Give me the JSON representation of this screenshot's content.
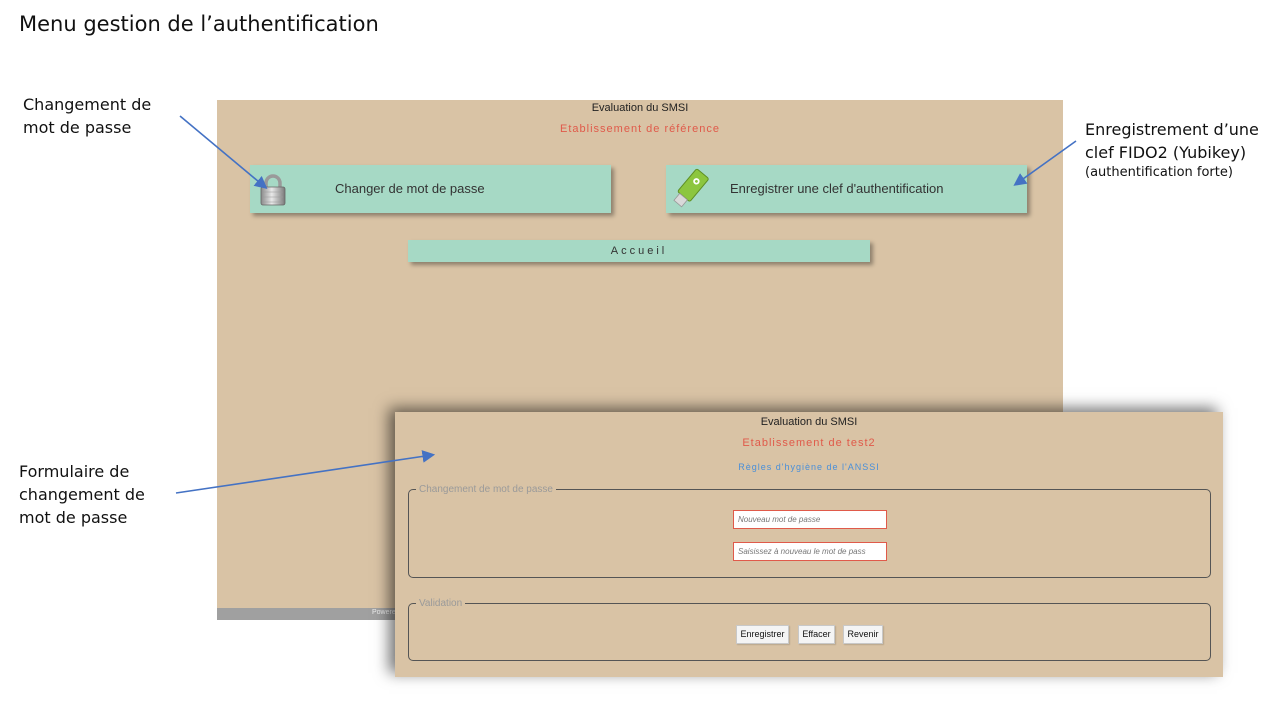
{
  "slide": {
    "title": "Menu gestion de l’authentification"
  },
  "callouts": {
    "password_change": [
      "Changement de",
      "mot de passe"
    ],
    "fido_key": [
      "Enregistrement d’une",
      "clef FIDO2 (Yubikey)"
    ],
    "fido_key_note": "(authentification forte)",
    "form": [
      "Formulaire de",
      "changement de",
      "mot de passe"
    ]
  },
  "main_screen": {
    "app_title": "Evaluation du SMSI",
    "establishment": "Etablissement de référence",
    "tiles": [
      {
        "label": "Changer de mot de passe",
        "icon": "padlock-icon"
      },
      {
        "label": "Enregistrer une clef d'authentification",
        "icon": "usb-key-icon"
      }
    ],
    "home_button": "Accueil",
    "footer_text": "Powere"
  },
  "form_screen": {
    "app_title": "Evaluation du SMSI",
    "establishment": "Etablissement de test2",
    "rules_link": "Règles d'hygiène de l'ANSSI",
    "password_section": {
      "legend": "Changement de mot de passe",
      "new_password_placeholder": "Nouveau mot de passe",
      "confirm_password_placeholder": "Saisissez à nouveau le mot de pass"
    },
    "validation_section": {
      "legend": "Validation",
      "buttons": [
        "Enregistrer",
        "Effacer",
        "Revenir"
      ]
    }
  },
  "colors": {
    "screen_background": "#d9c3a5",
    "tile_background": "#a6d9c5",
    "accent_red": "#e05a4a",
    "link_blue": "#4a8fd8",
    "arrow_blue": "#4472c4"
  }
}
